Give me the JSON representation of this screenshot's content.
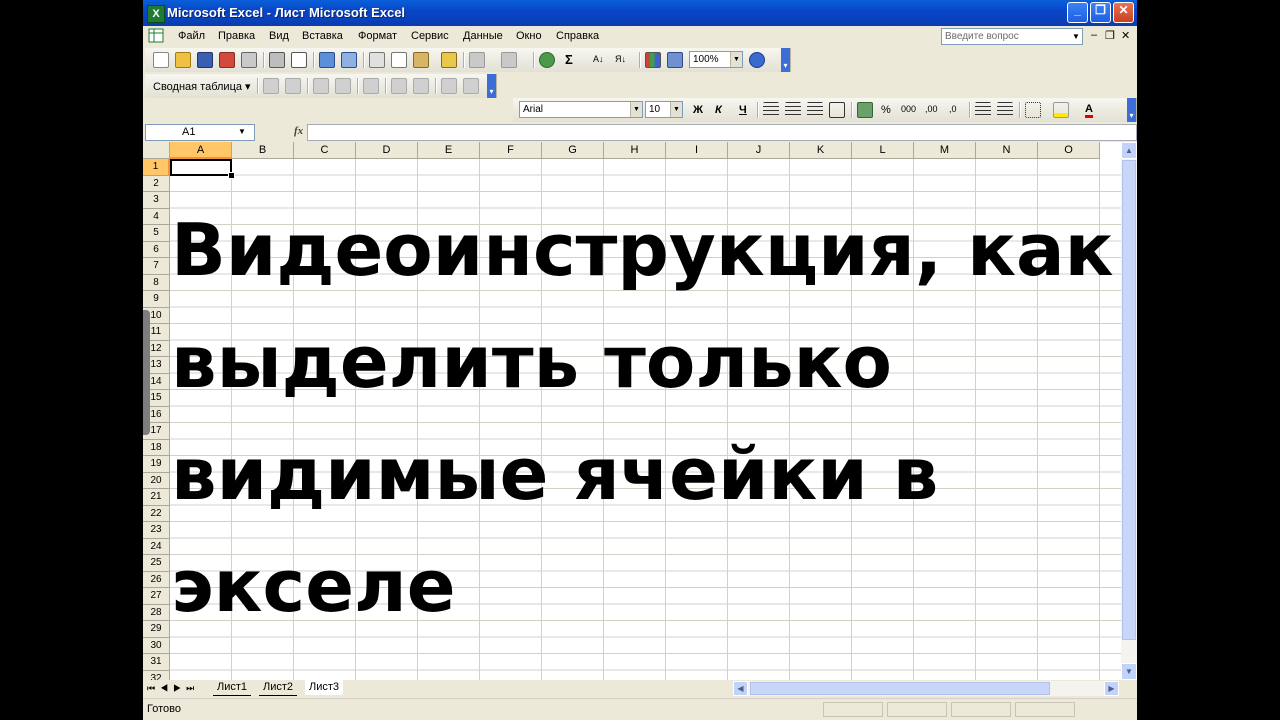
{
  "window": {
    "title": "Microsoft Excel - Лист Microsoft Excel",
    "app_icon": "X"
  },
  "menu": {
    "items": [
      "Файл",
      "Правка",
      "Вид",
      "Вставка",
      "Формат",
      "Сервис",
      "Данные",
      "Окно",
      "Справка"
    ],
    "help_placeholder": "Введите вопрос",
    "mdi_minimize": "–",
    "mdi_restore": "❐",
    "mdi_close": "✕"
  },
  "standard_toolbar": {
    "zoom": "100%",
    "sum": "Σ",
    "sort_asc": "А↓",
    "sort_desc": "Я↓"
  },
  "pivot_toolbar": {
    "label": "Сводная таблица ▾"
  },
  "format_toolbar": {
    "font": "Arial",
    "size": "10",
    "bold": "Ж",
    "italic": "К",
    "underline": "Ч",
    "percent": "%",
    "thousands": "000",
    "inc_dec": ",00",
    "dec_dec": ",0"
  },
  "formula_bar": {
    "name_box": "A1",
    "fx": "fx"
  },
  "grid": {
    "columns": [
      "A",
      "B",
      "C",
      "D",
      "E",
      "F",
      "G",
      "H",
      "I",
      "J",
      "K",
      "L",
      "M",
      "N",
      "O"
    ],
    "rows": [
      "1",
      "2",
      "3",
      "4",
      "5",
      "6",
      "7",
      "8",
      "9",
      "10",
      "11",
      "12",
      "13",
      "14",
      "15",
      "16",
      "17",
      "18",
      "19",
      "20",
      "21",
      "22",
      "23",
      "24",
      "25",
      "26",
      "27",
      "28",
      "29",
      "30",
      "31",
      "32"
    ],
    "active_cell": "A1"
  },
  "overlay": {
    "text": "Видеоинструкция, как выделить только видимые ячейки в экселе"
  },
  "sheet_tabs": [
    "Лист1",
    "Лист2",
    "Лист3"
  ],
  "active_sheet": "Лист3",
  "status": {
    "text": "Готово"
  },
  "colors": {
    "titlebar": "#0a5fd8",
    "selected_header": "#ffc768",
    "grid_line": "#d4d0c8"
  }
}
